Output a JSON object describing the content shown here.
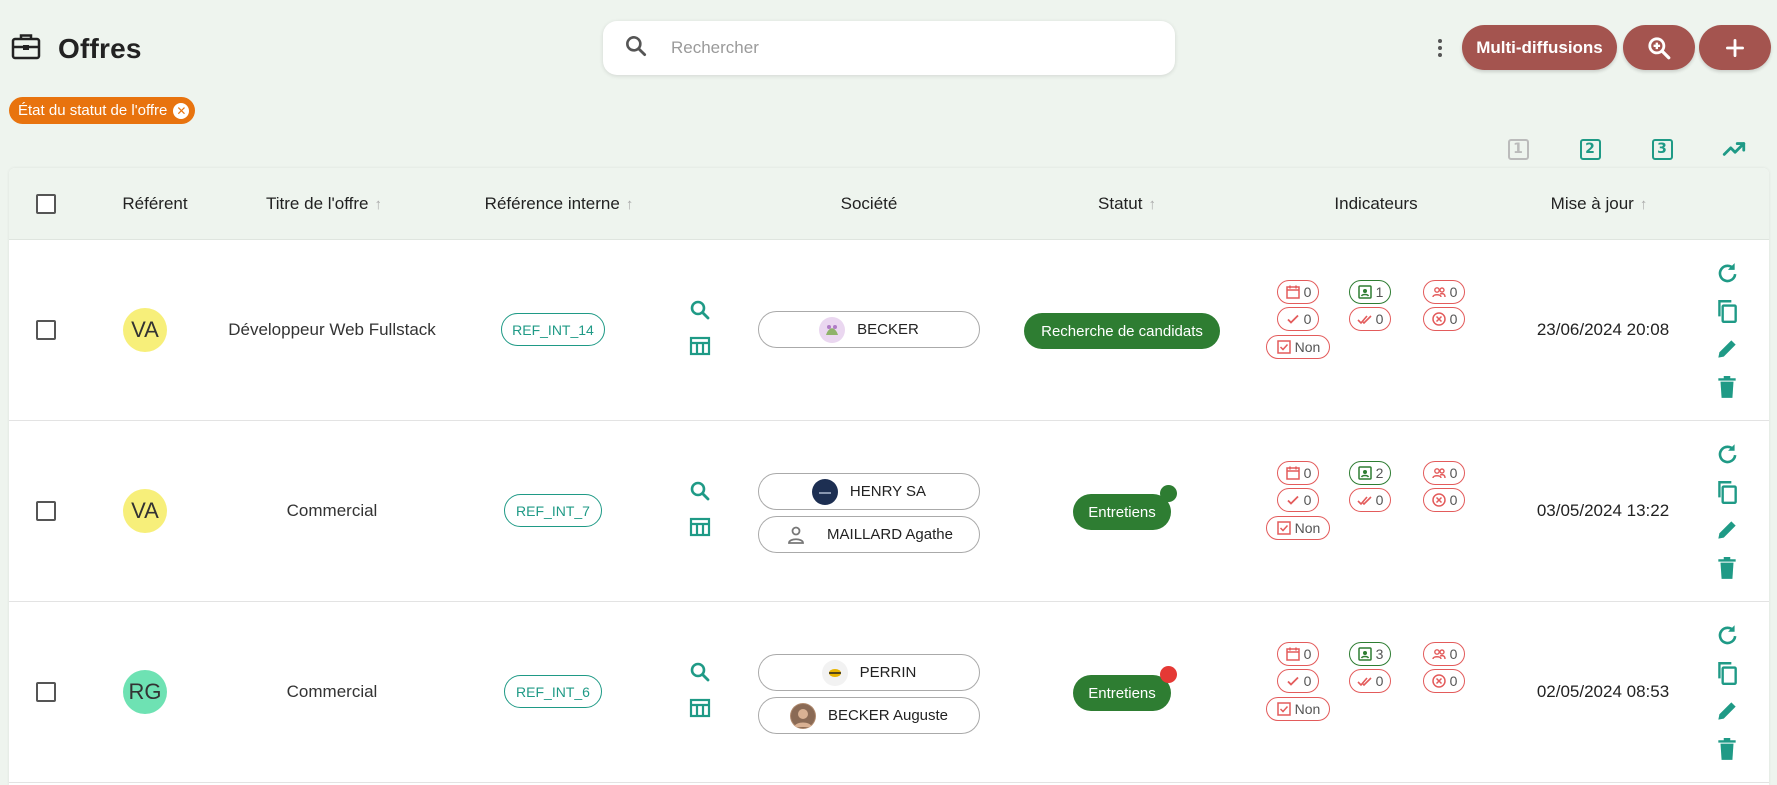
{
  "header": {
    "title": "Offres",
    "search_placeholder": "Rechercher",
    "multi_label": "Multi-diffusions"
  },
  "filter": {
    "chip_label": "État du statut de l'offre"
  },
  "view_switch": [
    "1",
    "2",
    "3"
  ],
  "columns": {
    "referent": "Référent",
    "titre": "Titre de l'offre",
    "reference": "Référence interne",
    "societe": "Société",
    "statut": "Statut",
    "indicateurs": "Indicateurs",
    "maj": "Mise à jour"
  },
  "sort_glyph": "↑",
  "rows": [
    {
      "initials": "VA",
      "avatar_color": "#f7ef7a",
      "title": "Développeur Web Fullstack",
      "ref": "REF_INT_14",
      "company": "BECKER",
      "contact": "",
      "status": "Recherche de candidats",
      "status_dot": "",
      "ind": {
        "calendar": "0",
        "candidat": "1",
        "group": "0",
        "check": "0",
        "doublecheck": "0",
        "cross": "0",
        "box": "Non"
      },
      "date": "23/06/2024 20:08"
    },
    {
      "initials": "VA",
      "avatar_color": "#f7ef7a",
      "title": "Commercial",
      "ref": "REF_INT_7",
      "company": "HENRY SA",
      "contact": "MAILLARD Agathe",
      "status": "Entretiens",
      "status_dot": "#2e7d32",
      "ind": {
        "calendar": "0",
        "candidat": "2",
        "group": "0",
        "check": "0",
        "doublecheck": "0",
        "cross": "0",
        "box": "Non"
      },
      "date": "03/05/2024 13:22"
    },
    {
      "initials": "RG",
      "avatar_color": "#6ee2b3",
      "title": "Commercial",
      "ref": "REF_INT_6",
      "company": "PERRIN",
      "contact": "BECKER Auguste",
      "status": "Entretiens",
      "status_dot": "#e53935",
      "ind": {
        "calendar": "0",
        "candidat": "3",
        "group": "0",
        "check": "0",
        "doublecheck": "0",
        "cross": "0",
        "box": "Non"
      },
      "date": "02/05/2024 08:53"
    }
  ],
  "colors": {
    "accent": "#1f9a86",
    "brand": "#a4544f",
    "chip": "#e8730e",
    "status_green": "#2e7d32",
    "indicator_red": "#e35b5b"
  }
}
